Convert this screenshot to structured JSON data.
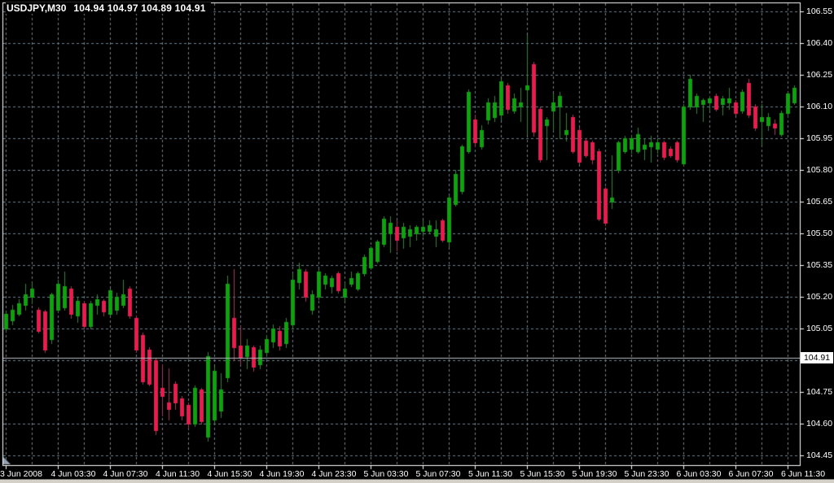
{
  "window": {
    "symbol_period": "USDJPY,M30",
    "ohlc_text": "104.94 104.97 104.89 104.91"
  },
  "chart_data": {
    "type": "candlestick",
    "title": "USDJPY,M30",
    "symbol": "USDJPY",
    "timeframe": "M30",
    "current_bar": {
      "open": 104.94,
      "high": 104.97,
      "low": 104.89,
      "close": 104.91
    },
    "bid_line": {
      "price": 104.91,
      "label": "104.91"
    },
    "colors": {
      "background": "#000000",
      "bull": "#0ca30c",
      "bear": "#ed1a4d",
      "grid": "#6e8091",
      "border": "#ffffff",
      "axis_text": "#ffffff",
      "bid_line": "#b9bec6",
      "tag_bg": "#ffffff",
      "tag_text": "#000000",
      "corner_triangle": "#93a1ae"
    },
    "y_axis": {
      "min": 104.45,
      "max": 106.55,
      "tick_step": 0.15,
      "labels": [
        "106.55",
        "106.40",
        "106.25",
        "106.10",
        "105.95",
        "105.80",
        "105.65",
        "105.50",
        "105.35",
        "105.20",
        "105.05",
        "104.75",
        "104.60",
        "104.45"
      ],
      "hidden_label_under_tag": "104.90"
    },
    "x_axis": {
      "labels": [
        "3 Jun 2008",
        "4 Jun 03:30",
        "4 Jun 07:30",
        "4 Jun 11:30",
        "4 Jun 15:30",
        "4 Jun 19:30",
        "4 Jun 23:30",
        "5 Jun 03:30",
        "5 Jun 07:30",
        "5 Jun 11:30",
        "5 Jun 15:30",
        "5 Jun 19:30",
        "5 Jun 23:30",
        "6 Jun 03:30",
        "6 Jun 07:30",
        "6 Jun 11:30"
      ],
      "bars_per_label": 8,
      "bars_per_gridline": 4
    },
    "grid": {
      "horizontal": "dashed",
      "vertical": "dashed"
    },
    "candles_ohlc": [
      [
        105.05,
        105.13,
        105.04,
        105.12
      ],
      [
        105.09,
        105.16,
        105.07,
        105.14
      ],
      [
        105.12,
        105.19,
        105.11,
        105.17
      ],
      [
        105.16,
        105.26,
        105.14,
        105.21
      ],
      [
        105.2,
        105.27,
        105.17,
        105.24
      ],
      [
        105.14,
        105.15,
        105.03,
        105.04
      ],
      [
        105.13,
        105.14,
        104.94,
        104.95
      ],
      [
        105.0,
        105.22,
        104.98,
        105.21
      ],
      [
        105.14,
        105.28,
        105.13,
        105.26
      ],
      [
        105.15,
        105.32,
        105.14,
        105.25
      ],
      [
        105.24,
        105.25,
        105.1,
        105.12
      ],
      [
        105.11,
        105.2,
        105.08,
        105.18
      ],
      [
        105.17,
        105.18,
        105.05,
        105.06
      ],
      [
        105.06,
        105.18,
        105.05,
        105.17
      ],
      [
        105.16,
        105.21,
        105.12,
        105.19
      ],
      [
        105.18,
        105.19,
        105.11,
        105.13
      ],
      [
        105.12,
        105.24,
        105.11,
        105.23
      ],
      [
        105.14,
        105.22,
        105.12,
        105.2
      ],
      [
        105.16,
        105.28,
        105.15,
        105.21
      ],
      [
        105.24,
        105.25,
        105.1,
        105.11
      ],
      [
        105.1,
        105.11,
        104.94,
        104.95
      ],
      [
        105.02,
        105.03,
        104.79,
        104.8
      ],
      [
        104.95,
        104.96,
        104.78,
        104.79
      ],
      [
        104.9,
        104.91,
        104.55,
        104.57
      ],
      [
        104.77,
        104.88,
        104.64,
        104.73
      ],
      [
        104.7,
        104.86,
        104.62,
        104.67
      ],
      [
        104.79,
        104.8,
        104.67,
        104.7
      ],
      [
        104.72,
        104.73,
        104.62,
        104.64
      ],
      [
        104.69,
        104.7,
        104.58,
        104.6
      ],
      [
        104.6,
        104.78,
        104.59,
        104.77
      ],
      [
        104.76,
        104.77,
        104.6,
        104.61
      ],
      [
        104.54,
        104.94,
        104.52,
        104.92
      ],
      [
        104.62,
        104.87,
        104.6,
        104.85
      ],
      [
        104.66,
        104.84,
        104.63,
        104.76
      ],
      [
        104.82,
        105.3,
        104.8,
        105.26
      ],
      [
        105.1,
        105.33,
        104.9,
        104.96
      ],
      [
        104.97,
        105.06,
        104.88,
        104.91
      ],
      [
        104.92,
        105.0,
        104.86,
        104.97
      ],
      [
        104.96,
        104.97,
        104.85,
        104.87
      ],
      [
        104.88,
        104.97,
        104.86,
        104.95
      ],
      [
        104.94,
        105.02,
        104.92,
        105.0
      ],
      [
        104.99,
        105.07,
        104.96,
        105.05
      ],
      [
        105.04,
        105.06,
        104.95,
        104.97
      ],
      [
        104.98,
        105.1,
        104.96,
        105.08
      ],
      [
        105.07,
        105.31,
        105.05,
        105.28
      ],
      [
        105.27,
        105.36,
        105.24,
        105.33
      ],
      [
        105.32,
        105.33,
        105.18,
        105.2
      ],
      [
        105.14,
        105.23,
        105.12,
        105.21
      ],
      [
        105.2,
        105.33,
        105.19,
        105.32
      ],
      [
        105.26,
        105.31,
        105.24,
        105.3
      ],
      [
        105.25,
        105.3,
        105.22,
        105.29
      ],
      [
        105.31,
        105.32,
        105.22,
        105.23
      ],
      [
        105.2,
        105.27,
        105.18,
        105.24
      ],
      [
        105.26,
        105.32,
        105.25,
        105.29
      ],
      [
        105.24,
        105.32,
        105.23,
        105.31
      ],
      [
        105.31,
        105.4,
        105.3,
        105.39
      ],
      [
        105.34,
        105.44,
        105.33,
        105.43
      ],
      [
        105.37,
        105.47,
        105.36,
        105.46
      ],
      [
        105.45,
        105.58,
        105.44,
        105.57
      ],
      [
        105.5,
        105.58,
        105.41,
        105.55
      ],
      [
        105.53,
        105.56,
        105.42,
        105.47
      ],
      [
        105.48,
        105.55,
        105.43,
        105.53
      ],
      [
        105.49,
        105.54,
        105.44,
        105.52
      ],
      [
        105.5,
        105.54,
        105.47,
        105.53
      ],
      [
        105.51,
        105.56,
        105.49,
        105.53
      ],
      [
        105.51,
        105.56,
        105.5,
        105.54
      ],
      [
        105.49,
        105.56,
        105.44,
        105.52
      ],
      [
        105.56,
        105.57,
        105.46,
        105.47
      ],
      [
        105.46,
        105.68,
        105.44,
        105.67
      ],
      [
        105.64,
        105.8,
        105.63,
        105.78
      ],
      [
        105.7,
        105.92,
        105.69,
        105.91
      ],
      [
        105.89,
        106.18,
        105.88,
        106.17
      ],
      [
        106.04,
        106.06,
        105.91,
        105.93
      ],
      [
        105.91,
        106.01,
        105.9,
        105.99
      ],
      [
        106.04,
        106.14,
        106.02,
        106.12
      ],
      [
        106.05,
        106.15,
        106.03,
        106.12
      ],
      [
        106.06,
        106.23,
        106.04,
        106.22
      ],
      [
        106.2,
        106.21,
        106.07,
        106.09
      ],
      [
        106.08,
        106.16,
        106.07,
        106.14
      ],
      [
        106.1,
        106.19,
        106.03,
        106.12
      ],
      [
        106.18,
        106.44,
        105.97,
        106.2
      ],
      [
        106.3,
        106.31,
        105.96,
        105.98
      ],
      [
        106.09,
        106.1,
        105.84,
        105.85
      ],
      [
        106.01,
        106.05,
        105.85,
        106.04
      ],
      [
        106.08,
        106.16,
        105.99,
        106.12
      ],
      [
        106.1,
        106.17,
        105.95,
        106.15
      ],
      [
        105.97,
        106.07,
        105.94,
        105.99
      ],
      [
        106.05,
        106.06,
        105.88,
        105.89
      ],
      [
        105.99,
        106.0,
        105.83,
        105.84
      ],
      [
        105.94,
        105.95,
        105.86,
        105.87
      ],
      [
        105.93,
        105.94,
        105.83,
        105.85
      ],
      [
        105.89,
        105.9,
        105.56,
        105.57
      ],
      [
        105.71,
        105.72,
        105.54,
        105.55
      ],
      [
        105.65,
        105.87,
        105.62,
        105.67
      ],
      [
        105.8,
        105.94,
        105.79,
        105.93
      ],
      [
        105.89,
        105.96,
        105.88,
        105.95
      ],
      [
        105.9,
        105.96,
        105.88,
        105.95
      ],
      [
        105.89,
        106.0,
        105.88,
        105.97
      ],
      [
        105.9,
        105.95,
        105.85,
        105.92
      ],
      [
        105.91,
        105.96,
        105.84,
        105.93
      ],
      [
        105.9,
        105.95,
        105.88,
        105.93
      ],
      [
        105.93,
        105.94,
        105.85,
        105.86
      ],
      [
        105.9,
        105.91,
        105.86,
        105.87
      ],
      [
        105.93,
        105.94,
        105.84,
        105.85
      ],
      [
        105.83,
        106.11,
        105.82,
        106.1
      ],
      [
        106.1,
        106.25,
        106.09,
        106.23
      ],
      [
        106.1,
        106.16,
        106.07,
        106.15
      ],
      [
        106.11,
        106.14,
        106.03,
        106.13
      ],
      [
        106.12,
        106.15,
        106.08,
        106.14
      ],
      [
        106.15,
        106.16,
        106.08,
        106.09
      ],
      [
        106.11,
        106.15,
        106.06,
        106.14
      ],
      [
        106.12,
        106.19,
        106.09,
        106.14
      ],
      [
        106.12,
        106.13,
        106.06,
        106.07
      ],
      [
        106.08,
        106.18,
        106.07,
        106.17
      ],
      [
        106.21,
        106.23,
        106.05,
        106.06
      ],
      [
        106.1,
        106.11,
        105.99,
        106.0
      ],
      [
        106.03,
        106.11,
        105.92,
        106.05
      ],
      [
        106.01,
        106.07,
        105.99,
        106.05
      ],
      [
        106.02,
        106.04,
        105.97,
        106.0
      ],
      [
        105.97,
        106.08,
        105.96,
        106.07
      ],
      [
        106.07,
        106.17,
        106.05,
        106.16
      ],
      [
        106.12,
        106.2,
        106.11,
        106.19
      ]
    ]
  }
}
